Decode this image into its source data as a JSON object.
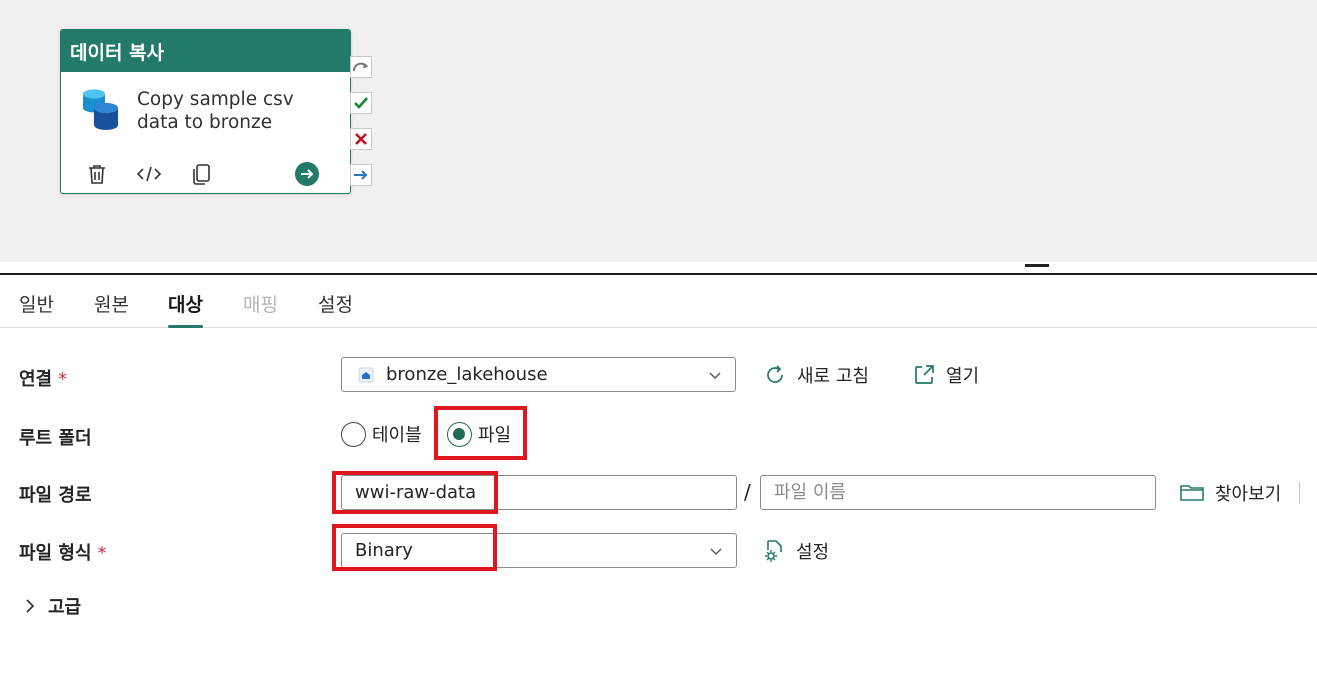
{
  "activity": {
    "header": "데이터 복사",
    "title": "Copy sample csv data to bronze"
  },
  "tabs": [
    {
      "label": "일반",
      "state": "normal"
    },
    {
      "label": "원본",
      "state": "normal"
    },
    {
      "label": "대상",
      "state": "active"
    },
    {
      "label": "매핑",
      "state": "disabled"
    },
    {
      "label": "설정",
      "state": "normal"
    }
  ],
  "form": {
    "connection": {
      "label": "연결",
      "required_mark": "*",
      "value": "bronze_lakehouse",
      "refresh_label": "새로 고침",
      "open_label": "열기"
    },
    "root_folder": {
      "label": "루트 폴더",
      "options": [
        "테이블",
        "파일"
      ],
      "selected": "파일"
    },
    "file_path": {
      "label": "파일 경로",
      "folder_value": "wwi-raw-data",
      "separator": "/",
      "filename_placeholder": "파일 이름",
      "browse_label": "찾아보기"
    },
    "file_format": {
      "label": "파일 형식",
      "required_mark": "*",
      "value": "Binary",
      "settings_label": "설정"
    },
    "advanced": {
      "label": "고급"
    }
  },
  "colors": {
    "accent": "#237a68",
    "highlight": "#e0161f",
    "required": "#c4314b"
  }
}
